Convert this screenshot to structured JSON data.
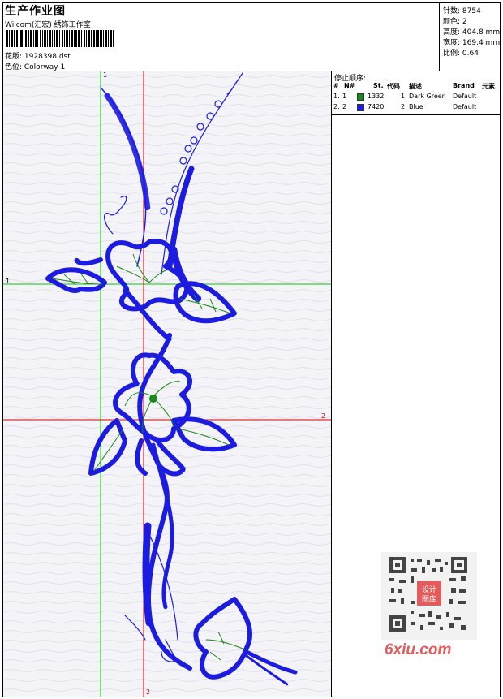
{
  "header": {
    "title": "生产作业图",
    "studio": "Wilcom(汇宏) 绣饰工作室",
    "design_file": "花版: 1928398.dst",
    "colorway": "色位: Colorway 1"
  },
  "stats": [
    {
      "label": "针数",
      "value": "8754"
    },
    {
      "label": "颜色",
      "value": "2"
    },
    {
      "label": "高度",
      "value": "404.8 mm"
    },
    {
      "label": "宽度",
      "value": "169.4 mm"
    },
    {
      "label": "比例",
      "value": "0.64"
    }
  ],
  "stop_sequence": {
    "title": "停止顺序:",
    "columns": [
      "#",
      "N#",
      "St.",
      "代码",
      "描述",
      "Brand",
      "元素"
    ],
    "rows": [
      {
        "idx": "1.",
        "no": "1",
        "swatch": "#1a8a1a",
        "stitches": "1332",
        "code": "1",
        "description": "Dark Green",
        "brand": "Default",
        "element": ""
      },
      {
        "idx": "2.",
        "no": "2",
        "swatch": "#1c1ce0",
        "stitches": "7420",
        "code": "2",
        "description": "Blue",
        "brand": "Default",
        "element": ""
      }
    ]
  },
  "guides": {
    "green_v": "1",
    "green_h": "1",
    "red_h": "2",
    "red_v": "2"
  },
  "colors": {
    "thread_blue": "#1c1ce0",
    "thread_green": "#1a8a1a",
    "guide_green": "#00cc00",
    "guide_red": "#dd0000",
    "canvas_bg": "#f4f3f7"
  },
  "watermark": {
    "text": "6xiu.com",
    "qr_center": "设计图库"
  }
}
